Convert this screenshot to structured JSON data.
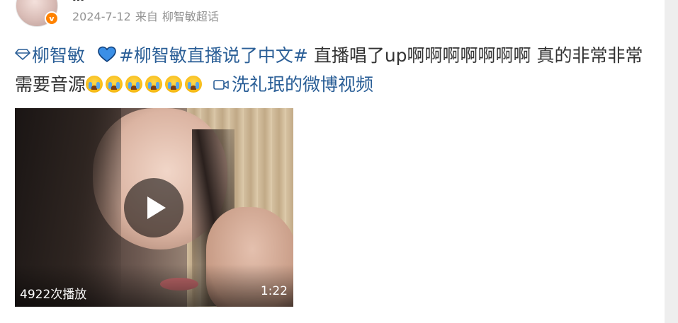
{
  "header": {
    "username_fragment": "…",
    "verified_badge": "v",
    "date": "2024-7-12",
    "source_prefix": "来自",
    "source": "柳智敏超话"
  },
  "post": {
    "topic_user": "柳智敏",
    "topic_tag": "#柳智敏直播说了中文#",
    "body_line": "直播唱了up啊啊啊啊啊啊啊 真的非常非常需要音源",
    "emoji_name": "crying-emoji",
    "emoji_count": 6,
    "video_link": "洗礼珉的微博视频"
  },
  "video": {
    "play_count": "4922次播放",
    "duration": "1:22"
  },
  "colors": {
    "link": "#2b5f97",
    "text": "#333333",
    "meta": "#939393",
    "badge": "#ff8200"
  }
}
